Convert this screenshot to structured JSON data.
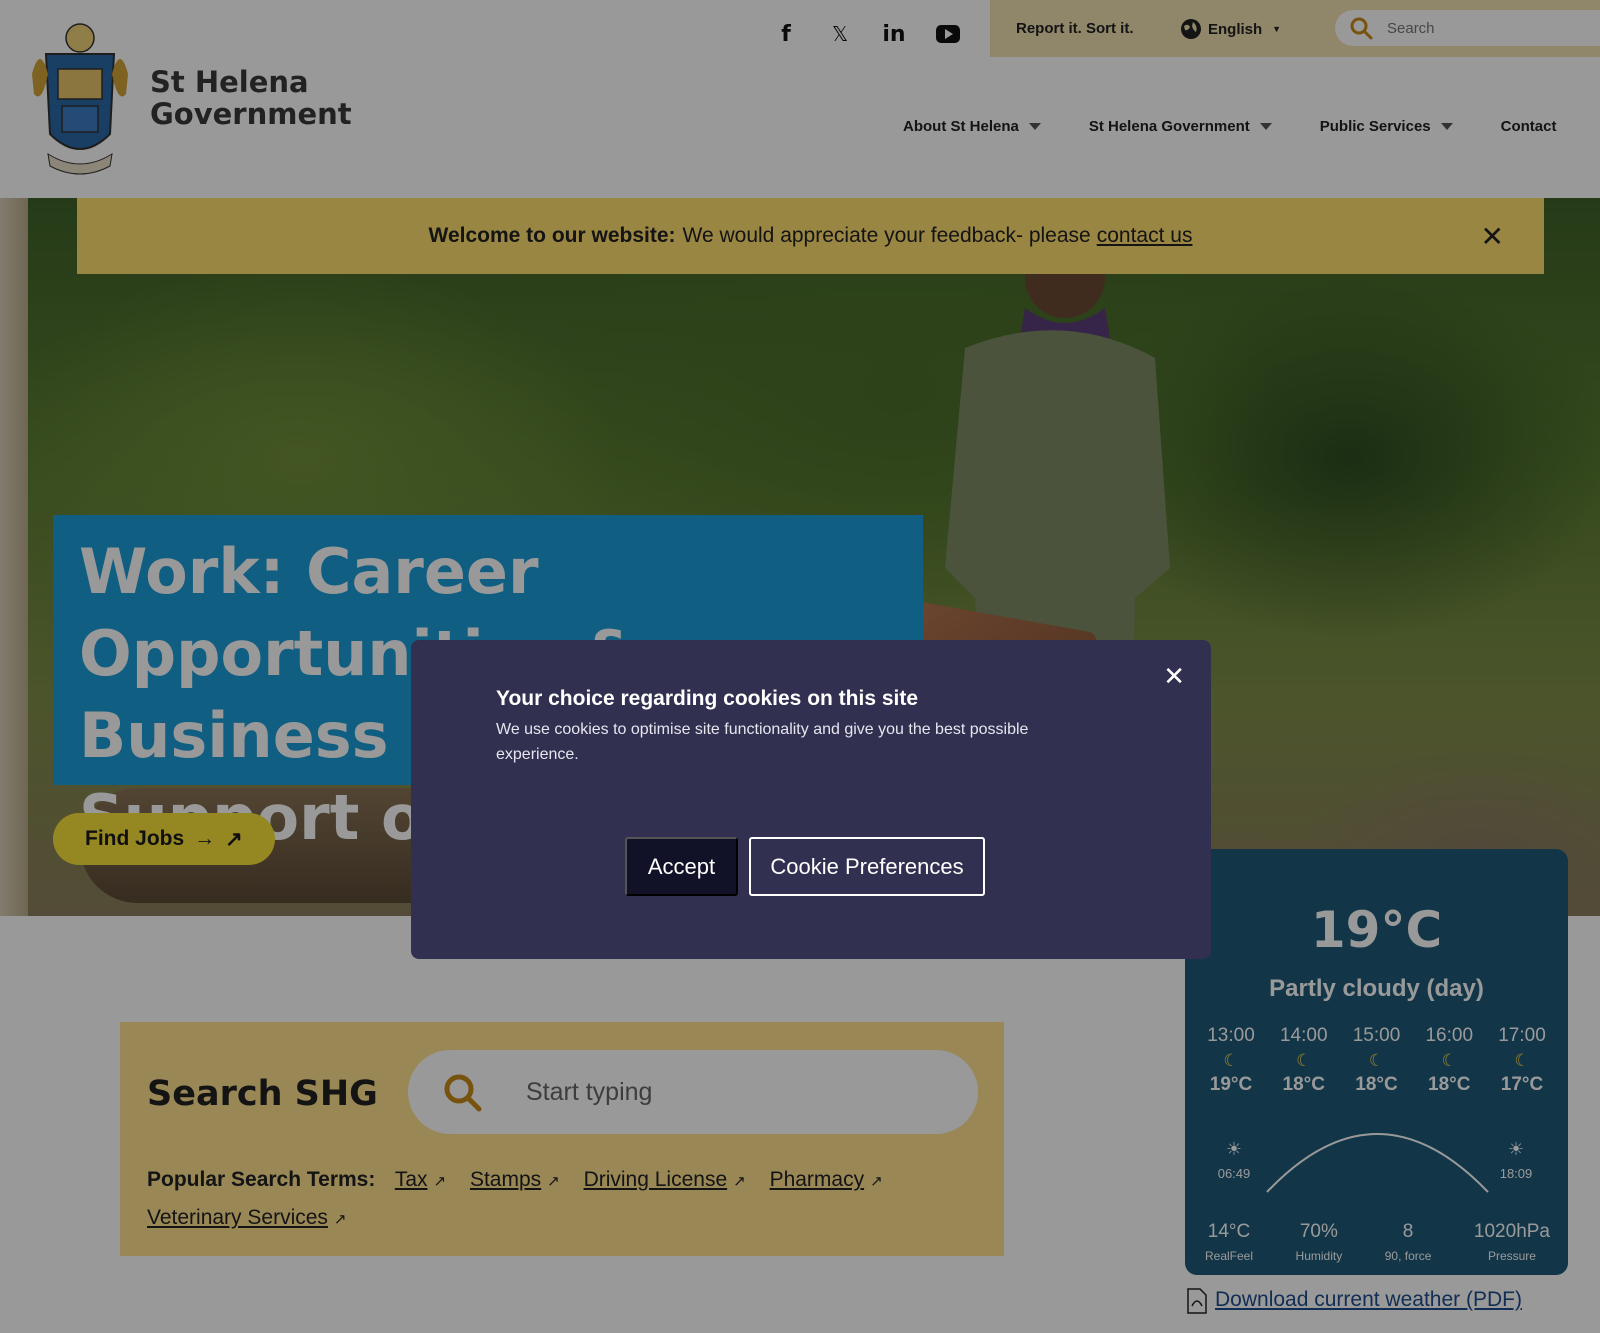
{
  "header": {
    "brand_line1": "St Helena",
    "brand_line2": "Government",
    "social": {
      "facebook": "f",
      "x": "𝕏",
      "linkedin": "in",
      "youtube": "▶"
    },
    "report_label": "Report it. Sort it.",
    "language_label": "English",
    "search_placeholder": "Search",
    "nav": [
      {
        "label": "About St Helena"
      },
      {
        "label": "St Helena Government"
      },
      {
        "label": "Public Services"
      },
      {
        "label": "Contact"
      }
    ]
  },
  "announcement": {
    "bold": "Welcome to our website:",
    "text": "We would appreciate your feedback- please",
    "link": "contact us",
    "close": "✕"
  },
  "hero": {
    "title_line1": "Work: Career",
    "title_line2": "Opportunities & Business",
    "title_line3": "Support on St Helena",
    "cta_label": "Find Jobs",
    "cta_arrow": "→",
    "cta_ext": "↗"
  },
  "weather": {
    "temperature": "19°C",
    "condition": "Partly cloudy (day)",
    "hours": [
      {
        "time": "13:00",
        "temp": "19°C"
      },
      {
        "time": "14:00",
        "temp": "18°C"
      },
      {
        "time": "15:00",
        "temp": "18°C"
      },
      {
        "time": "16:00",
        "temp": "18°C"
      },
      {
        "time": "17:00",
        "temp": "17°C"
      }
    ],
    "sunrise": "06:49",
    "sunset": "18:09",
    "stats": [
      {
        "value": "14°C",
        "label": "RealFeel"
      },
      {
        "value": "70%",
        "label": "Humidity"
      },
      {
        "value": "8",
        "label": "90, force"
      },
      {
        "value": "1020hPa",
        "label": "Pressure"
      }
    ],
    "download_label": "Download current weather (PDF)"
  },
  "search_shg": {
    "title": "Search SHG",
    "placeholder": "Start typing",
    "popular_label": "Popular Search Terms:",
    "terms": [
      "Tax",
      "Stamps",
      "Driving License",
      "Pharmacy",
      "Veterinary Services"
    ]
  },
  "cookie_modal": {
    "title": "Your choice regarding cookies on this site",
    "body": "We use cookies to optimise site functionality and give you the best possible experience.",
    "accept_label": "Accept",
    "prefs_label": "Cookie Preferences",
    "close": "✕"
  },
  "colors": {
    "hero_title_bg": "#1c9dd8",
    "announcement_bg": "#ffdf6e",
    "cta_bg": "#f9e339",
    "utility_bg": "#f0dfb0",
    "weather_bg": "#1f5a79",
    "modal_bg": "#313051",
    "accept_bg": "#111128"
  },
  "icons": [
    "facebook-icon",
    "x-twitter-icon",
    "linkedin-icon",
    "youtube-icon",
    "globe-icon",
    "search-icon",
    "close-icon",
    "external-link-icon",
    "moon-icon",
    "sunrise-icon",
    "sunset-icon",
    "pdf-icon"
  ]
}
